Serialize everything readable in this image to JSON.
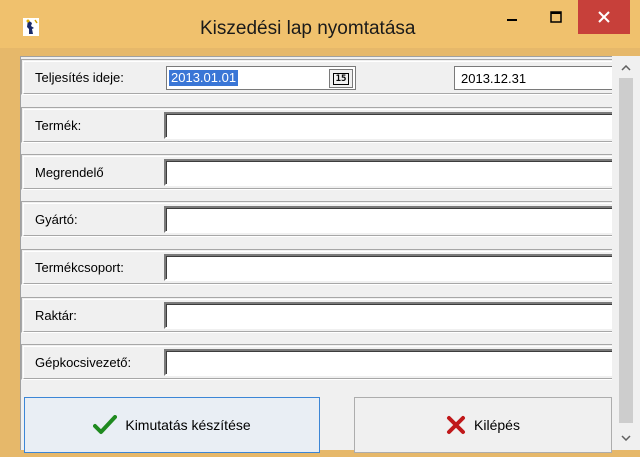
{
  "window": {
    "title": "Kiszedési lap nyomtatása",
    "app_icon": "wizard-app-icon",
    "controls": [
      "minimize-icon",
      "maximize-icon",
      "close-icon"
    ],
    "colors": {
      "frame": "#f0c16d",
      "close": "#c7403a",
      "selection": "#3a76d6"
    }
  },
  "form": {
    "date": {
      "label": "Teljesítés ideje:",
      "from": "2013.01.01",
      "to": "2013.12.31",
      "calendar_glyph": "15"
    },
    "product": {
      "label": "Termék:",
      "value": ""
    },
    "customer": {
      "label": "Megrendelő",
      "value": ""
    },
    "manufacturer": {
      "label": "Gyártó:",
      "value": ""
    },
    "product_group": {
      "label": "Termékcsoport:",
      "value": ""
    },
    "warehouse": {
      "label": "Raktár:",
      "value": ""
    },
    "driver": {
      "label": "Gépkocsivezető:",
      "value": ""
    }
  },
  "buttons": {
    "report": {
      "label": "Kimutatás készítése",
      "icon": "checkmark-icon",
      "icon_color": "#1f8a1f"
    },
    "exit": {
      "label": "Kilépés",
      "icon": "x-icon",
      "icon_color": "#c0181a"
    }
  }
}
